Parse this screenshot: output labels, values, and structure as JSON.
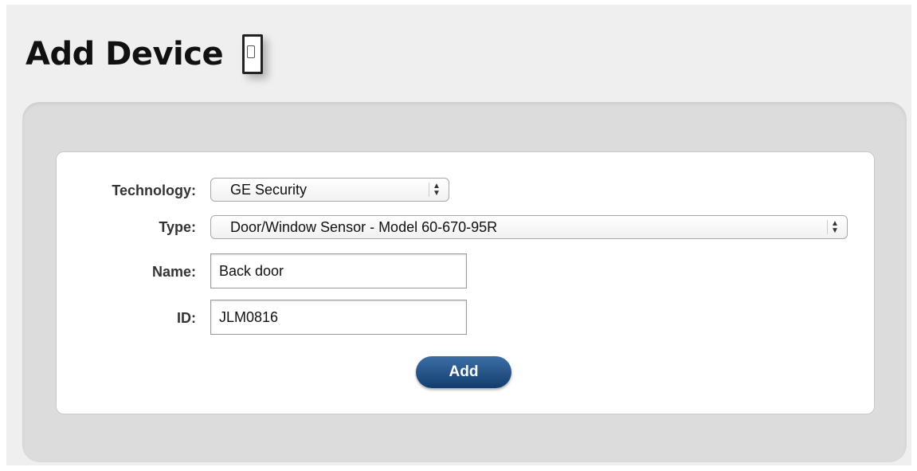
{
  "page": {
    "title": "Add Device"
  },
  "icons": {
    "title_icon": "door-icon"
  },
  "form": {
    "technology": {
      "label": "Technology:",
      "value": "GE Security"
    },
    "type": {
      "label": "Type:",
      "value": "Door/Window Sensor - Model 60-670-95R"
    },
    "name": {
      "label": "Name:",
      "value": "Back door"
    },
    "id": {
      "label": "ID:",
      "value": "JLM0816"
    },
    "submit_label": "Add"
  },
  "colors": {
    "button": "#1b4a80",
    "panel": "#dcdcdc",
    "card": "#ffffff"
  }
}
